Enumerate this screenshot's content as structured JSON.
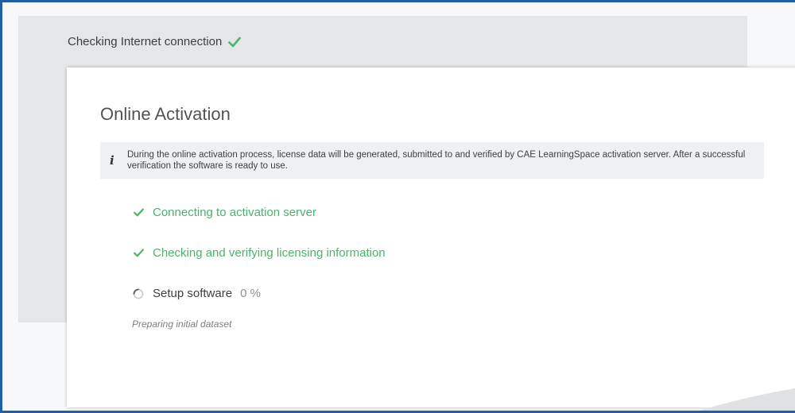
{
  "header": {
    "connection_status": "Checking Internet connection"
  },
  "card": {
    "title": "Online Activation",
    "info_text": "During the online activation process, license data will be generated, submitted to and verified by CAE LearningSpace activation server. After a successful verification the software is ready to use.",
    "steps": [
      {
        "label": "Connecting to activation server",
        "state": "done"
      },
      {
        "label": "Checking and verifying licensing information",
        "state": "done"
      },
      {
        "label": "Setup software",
        "state": "in-progress",
        "percent": "0 %"
      }
    ],
    "substatus": "Preparing initial dataset"
  },
  "colors": {
    "success": "#4bb36b",
    "frame_border": "#1f5fa8",
    "panel_bg": "#e4e6e8"
  },
  "icons": {
    "done": "check-icon",
    "progress": "spinner-icon",
    "info": "info-icon"
  }
}
